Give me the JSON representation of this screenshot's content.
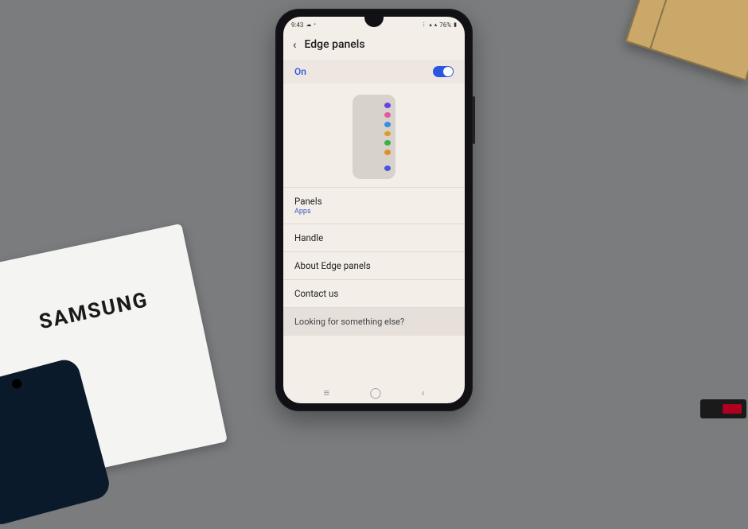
{
  "statusbar": {
    "time": "9:43",
    "battery_text": "76%"
  },
  "header": {
    "title": "Edge panels"
  },
  "toggle": {
    "label": "On",
    "state": "on"
  },
  "rows": {
    "panels": {
      "title": "Panels",
      "sub": "Apps"
    },
    "handle": {
      "title": "Handle"
    },
    "about": {
      "title": "About Edge panels"
    },
    "contact": {
      "title": "Contact us"
    }
  },
  "footer": {
    "text": "Looking for something else?"
  },
  "box": {
    "brand": "SAMSUNG"
  }
}
